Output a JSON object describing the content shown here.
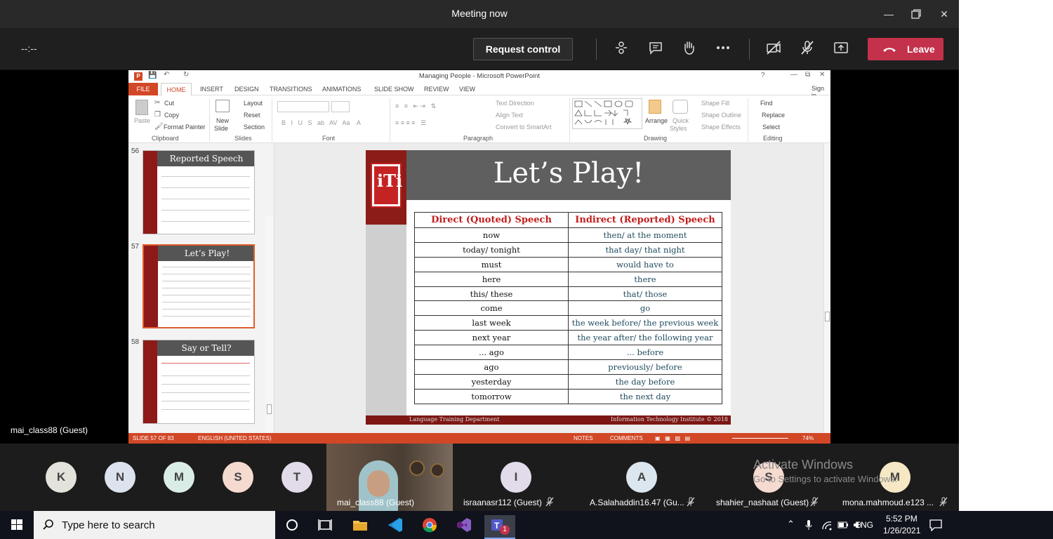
{
  "window": {
    "title": "Meeting now"
  },
  "meeting": {
    "timer": "--:--",
    "request_control": "Request control",
    "leave": "Leave",
    "presenter_label": "mai_class88 (Guest)"
  },
  "ppt": {
    "title": "Managing People - Microsoft PowerPoint",
    "sign_in": "Sign in",
    "tabs": [
      "FILE",
      "HOME",
      "INSERT",
      "DESIGN",
      "TRANSITIONS",
      "ANIMATIONS",
      "SLIDE SHOW",
      "REVIEW",
      "VIEW"
    ],
    "ribbon": {
      "paste": "Paste",
      "cut": "Cut",
      "copy": "Copy",
      "format_painter": "Format Painter",
      "clipboard": "Clipboard",
      "new_slide": "New",
      "new_slide2": "Slide",
      "layout": "Layout",
      "reset": "Reset",
      "section": "Section",
      "slides": "Slides",
      "font": "Font",
      "text_direction": "Text Direction",
      "align_text": "Align Text",
      "convert_smartart": "Convert to SmartArt",
      "paragraph": "Paragraph",
      "arrange": "Arrange",
      "quick_styles": "Quick",
      "quick_styles2": "Styles",
      "shape_fill": "Shape Fill",
      "shape_outline": "Shape Outline",
      "shape_effects": "Shape Effects",
      "drawing": "Drawing",
      "find": "Find",
      "replace": "Replace",
      "select": "Select",
      "editing": "Editing"
    },
    "thumbnails": [
      {
        "num": "56",
        "title": "Reported Speech"
      },
      {
        "num": "57",
        "title": "Let’s Play!"
      },
      {
        "num": "58",
        "title": "Say or Tell?"
      }
    ],
    "slide": {
      "title": "Let’s Play!",
      "col_left": "Direct (Quoted) Speech",
      "col_right": "Indirect (Reported) Speech",
      "rows": [
        [
          "now",
          "then/ at the moment"
        ],
        [
          "today/ tonight",
          "that day/ that night"
        ],
        [
          "must",
          "would have to"
        ],
        [
          "here",
          "there"
        ],
        [
          "this/ these",
          "that/ those"
        ],
        [
          "come",
          "go"
        ],
        [
          "last week",
          "the week before/ the previous week"
        ],
        [
          "next year",
          "the year after/ the following year"
        ],
        [
          "... ago",
          "... before"
        ],
        [
          "ago",
          "previously/ before"
        ],
        [
          "yesterday",
          "the day before"
        ],
        [
          "tomorrow",
          "the next day"
        ]
      ],
      "footer_left": "Language Training Department",
      "footer_right": "Information Technology Institute © 2018"
    },
    "status": {
      "slide": "SLIDE 57 OF 83",
      "language": "ENGLISH (UNITED STATES)",
      "notes": "NOTES",
      "comments": "COMMENTS",
      "zoom": "74%"
    }
  },
  "participants": [
    {
      "initial": "K",
      "color": "#e3e3dc"
    },
    {
      "initial": "N",
      "color": "#dde3ee"
    },
    {
      "initial": "M",
      "color": "#d9ede6"
    },
    {
      "initial": "S",
      "color": "#f5dad0"
    },
    {
      "initial": "T",
      "color": "#e2dcea"
    },
    {
      "initial": "I",
      "color": "#e2dcea",
      "name": "israanasr112 (Guest)"
    },
    {
      "initial": "A",
      "color": "#dce6ee",
      "name": "A.Salahaddin16.47 (Gu..."
    },
    {
      "initial": "S",
      "color": "#f5dad0",
      "name": "shahier_nashaat (Guest)"
    },
    {
      "initial": "M",
      "color": "#f6e8c4",
      "name": "mona.mahmoud.e123 ..."
    }
  ],
  "video_label": "mai_class88 (Guest)",
  "watermark": {
    "line1": "Activate Windows",
    "line2": "Go to Settings to activate Windows."
  },
  "taskbar": {
    "search_placeholder": "Type here to search",
    "lang": "ENG",
    "time": "5:52 PM",
    "date": "1/26/2021",
    "teams_badge": "1"
  }
}
